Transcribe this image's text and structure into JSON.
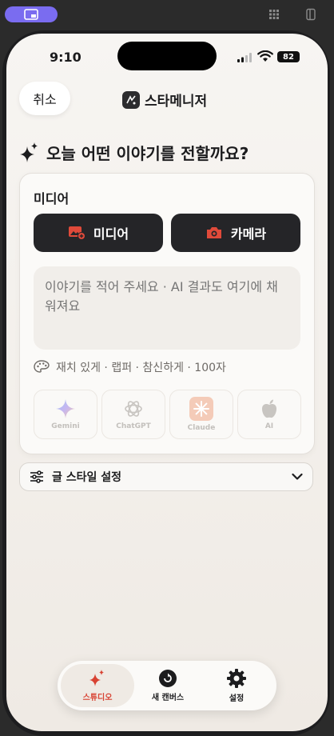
{
  "status_bar": {
    "time": "9:10",
    "battery": "82"
  },
  "header": {
    "cancel_label": "취소",
    "app_name": "스타메니저"
  },
  "prompt": {
    "heading": "오늘 어떤 이야기를 전할까요?"
  },
  "media": {
    "section_label": "미디어",
    "media_button_label": "미디어",
    "camera_button_label": "카메라",
    "story_placeholder": "이야기를 적어 주세요 · AI 결과도 여기에 채워져요"
  },
  "style_summary": "재치 있게 · 랩퍼 · 참신하게 · 100자",
  "ai_models": [
    {
      "label": "Gemini",
      "icon": "gemini-icon"
    },
    {
      "label": "ChatGPT",
      "icon": "chatgpt-icon"
    },
    {
      "label": "Claude",
      "icon": "claude-icon"
    },
    {
      "label": "AI",
      "icon": "apple-icon"
    }
  ],
  "style_settings": {
    "label": "글 스타일 설정"
  },
  "tabbar": {
    "tabs": [
      {
        "label": "스튜디오",
        "icon": "sparkle-icon"
      },
      {
        "label": "새 캔버스",
        "icon": "new-canvas-icon"
      },
      {
        "label": "설정",
        "icon": "gear-icon"
      }
    ],
    "active_color": "#d84232"
  },
  "colors": {
    "dark_button": "#252528",
    "accent_red": "#e04a3a"
  }
}
